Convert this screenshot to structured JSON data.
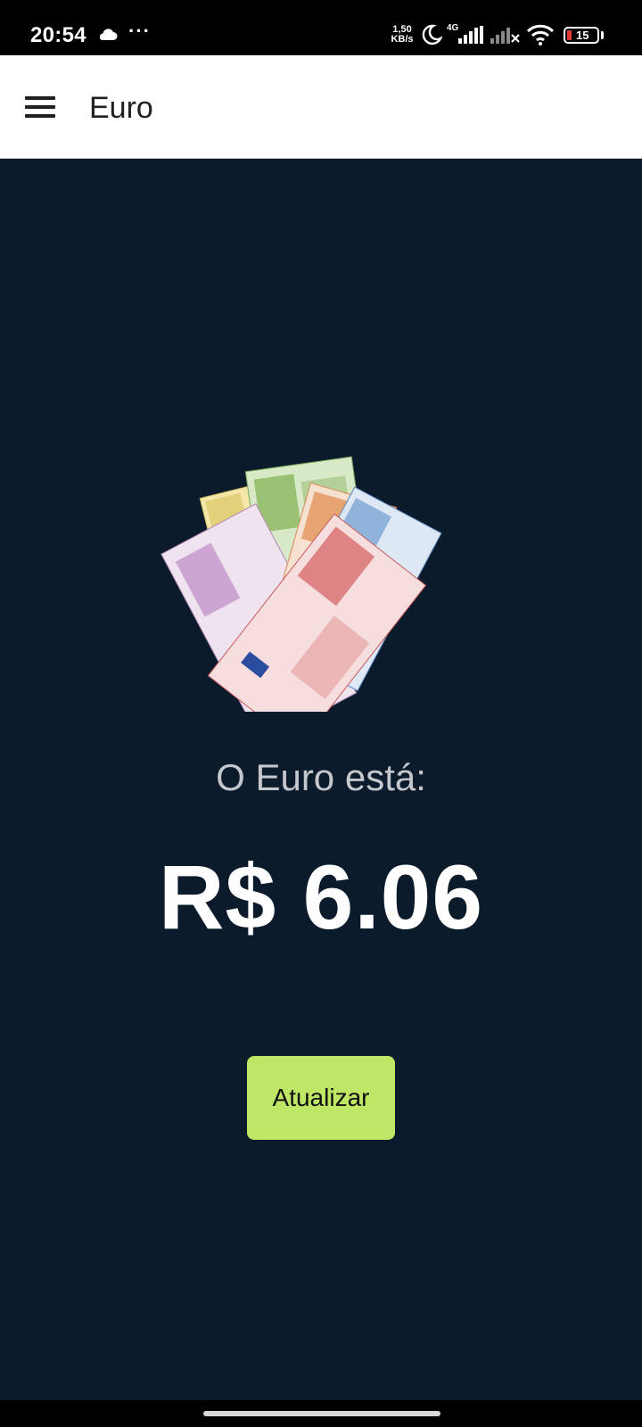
{
  "status_bar": {
    "time": "20:54",
    "speed": "1,50 KB/s",
    "network": "4G",
    "battery": "15",
    "icons": [
      "cloud-icon",
      "more-dots-icon",
      "moon-icon",
      "signal-icon",
      "signal-x-icon",
      "wifi-icon",
      "battery-icon"
    ]
  },
  "app_bar": {
    "title": "Euro",
    "menu_icon": "hamburger-menu-icon"
  },
  "main": {
    "image_description_icon": "euro-banknotes-image",
    "label": "O Euro está:",
    "value": "R$ 6.06",
    "button_label": "Atualizar"
  },
  "colors": {
    "background": "#0c1b2b",
    "app_bar": "#ffffff",
    "button": "#c0e665",
    "value_text": "#ffffff",
    "label_text": "#c4c8cc"
  }
}
